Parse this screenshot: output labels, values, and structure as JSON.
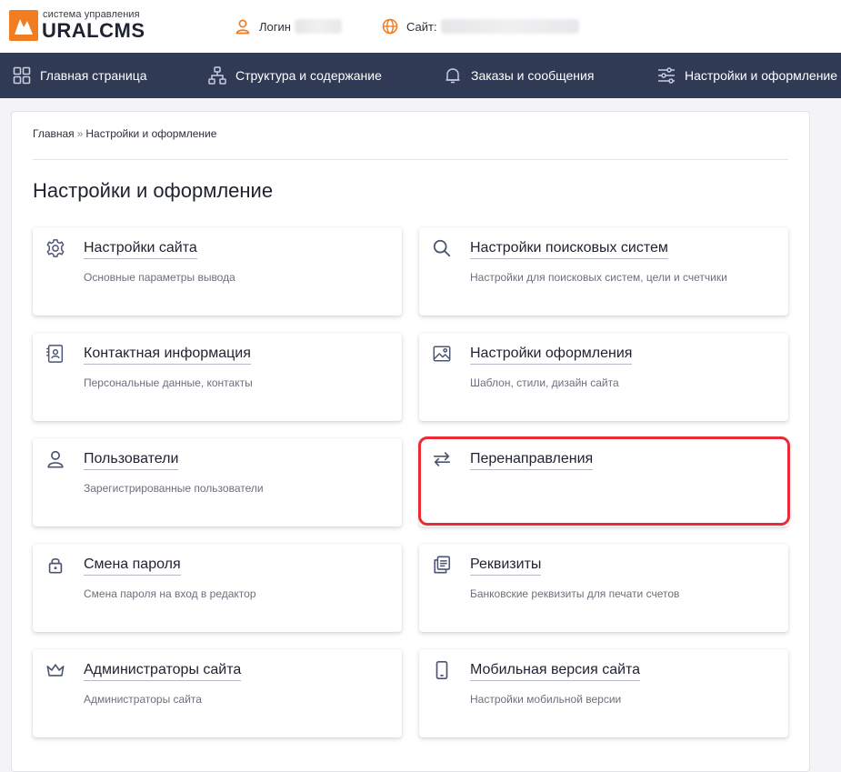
{
  "header": {
    "logo_subtitle": "система управления",
    "logo_name": "URALCMS",
    "login_label": "Логин",
    "site_label": "Сайт:"
  },
  "nav": [
    {
      "label": "Главная страница",
      "icon": "grid-icon"
    },
    {
      "label": "Структура и содержание",
      "icon": "sitemap-icon"
    },
    {
      "label": "Заказы и сообщения",
      "icon": "bell-icon"
    },
    {
      "label": "Настройки и оформление",
      "icon": "sliders-icon"
    }
  ],
  "breadcrumb": {
    "home": "Главная",
    "separator": "»",
    "current": "Настройки и оформление"
  },
  "page_title": "Настройки и оформление",
  "cards": [
    {
      "title": "Настройки сайта",
      "desc": "Основные параметры вывода",
      "icon": "gear-icon"
    },
    {
      "title": "Настройки поисковых систем",
      "desc": "Настройки для поисковых систем, цели и счетчики",
      "icon": "search-icon"
    },
    {
      "title": "Контактная информация",
      "desc": "Персональные данные, контакты",
      "icon": "contact-card-icon"
    },
    {
      "title": "Настройки оформления",
      "desc": "Шаблон, стили, дизайн сайта",
      "icon": "image-icon"
    },
    {
      "title": "Пользователи",
      "desc": "Зарегистрированные пользователи",
      "icon": "user-icon"
    },
    {
      "title": "Перенаправления",
      "desc": "",
      "icon": "redirect-arrows-icon"
    },
    {
      "title": "Смена пароля",
      "desc": "Смена пароля на вход в редактор",
      "icon": "lock-icon"
    },
    {
      "title": "Реквизиты",
      "desc": "Банковские реквизиты для печати счетов",
      "icon": "documents-icon"
    },
    {
      "title": "Администраторы сайта",
      "desc": "Администраторы сайта",
      "icon": "crown-icon"
    },
    {
      "title": "Мобильная версия сайта",
      "desc": "Настройки мобильной версии",
      "icon": "mobile-icon"
    }
  ],
  "colors": {
    "brand_orange": "#f07d22",
    "nav_bg": "#313a55",
    "highlight": "#ea2b36",
    "icon": "#4b5472"
  }
}
